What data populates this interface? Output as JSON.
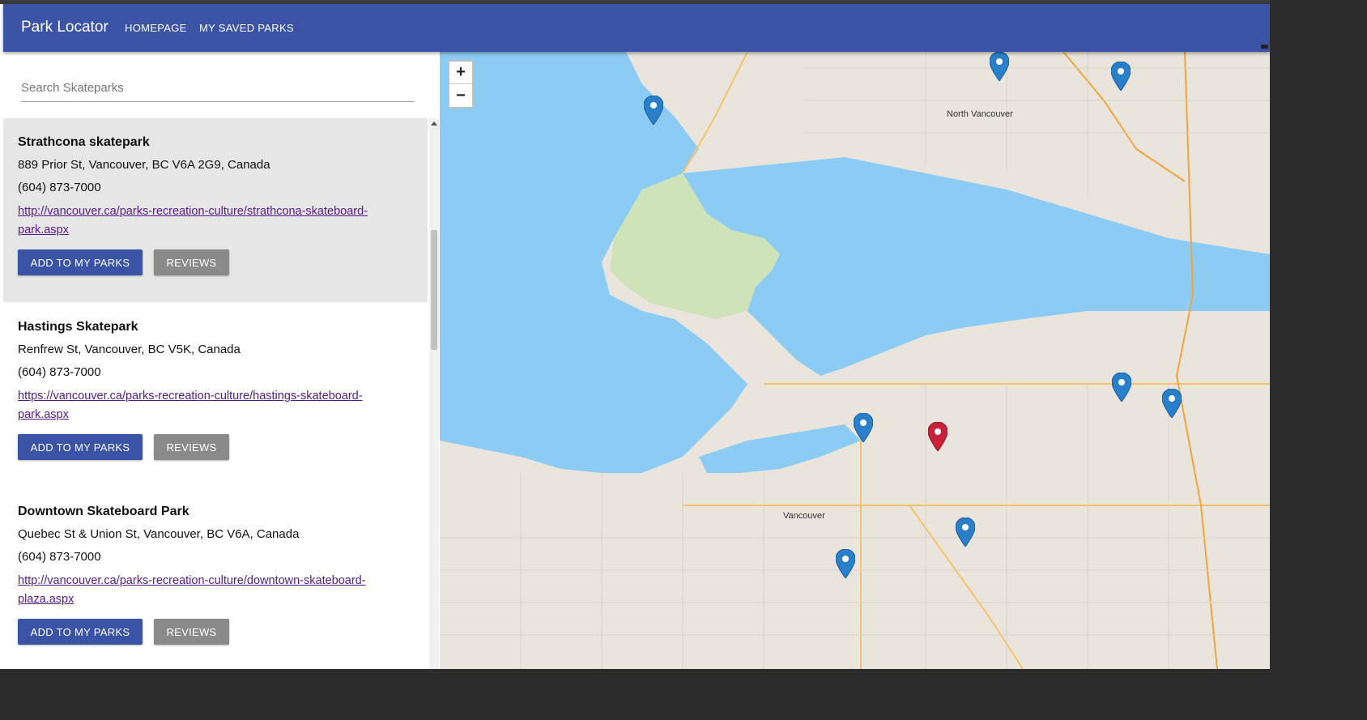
{
  "navbar": {
    "brand": "Park Locator",
    "links": [
      "HOMEPAGE",
      "MY SAVED PARKS"
    ],
    "color": "#3a53a4"
  },
  "search": {
    "placeholder": "Search Skateparks"
  },
  "parks": [
    {
      "name": "Strathcona skatepark",
      "address": "889 Prior St, Vancouver, BC V6A 2G9, Canada",
      "phone": "(604) 873-7000",
      "url": "http://vancouver.ca/parks-recreation-culture/strathcona-skateboard-park.aspx",
      "add_label": "ADD TO MY PARKS",
      "reviews_label": "REVIEWS",
      "selected": true
    },
    {
      "name": "Hastings Skatepark",
      "address": "Renfrew St, Vancouver, BC V5K, Canada",
      "phone": "(604) 873-7000",
      "url": "https://vancouver.ca/parks-recreation-culture/hastings-skateboard-park.aspx",
      "add_label": "ADD TO MY PARKS",
      "reviews_label": "REVIEWS",
      "selected": false
    },
    {
      "name": "Downtown Skateboard Park",
      "address": "Quebec St & Union St, Vancouver, BC V6A, Canada",
      "phone": "(604) 873-7000",
      "url": "http://vancouver.ca/parks-recreation-culture/downtown-skateboard-plaza.aspx",
      "add_label": "ADD TO MY PARKS",
      "reviews_label": "REVIEWS",
      "selected": false
    }
  ],
  "map": {
    "zoom_in": "+",
    "zoom_out": "−",
    "labels": {
      "north_vancouver": "North Vancouver",
      "vancouver": "Vancouver"
    },
    "marker_color": "#2a7fcb",
    "selected_marker_color": "#c8233a"
  }
}
